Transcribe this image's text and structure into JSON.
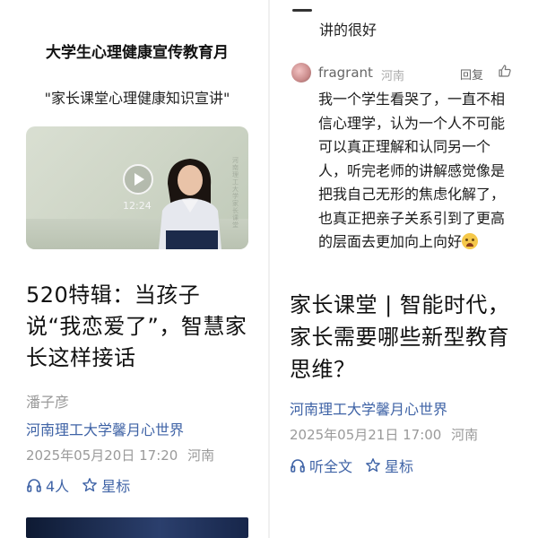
{
  "left_article": {
    "banner_title": "大学生心理健康宣传教育月",
    "banner_subtitle": "\"家长课堂心理健康知识宣讲\"",
    "video": {
      "duration": "12:24",
      "vertical_text": "河南理工大学家长课堂"
    },
    "headline": "520特辑：当孩子说“我恋爱了”，智慧家长这样接话",
    "author": "潘子彦",
    "source": "河南理工大学馨月心世界",
    "date": "2025年05月20日 17:20",
    "location": "河南",
    "listeners": "4人",
    "star_label": "星标"
  },
  "right_article": {
    "previous_comment": "讲的很好",
    "comment": {
      "user": "fragrant",
      "location": "河南",
      "reply_label": "回复",
      "text": "我一个学生看哭了，一直不相信心理学，认为一个人不可能可以真正理解和认同另一个人，听完老师的讲解感觉像是把我自己无形的焦虑化解了，也真正把亲子关系引到了更高的层面去更加向上向好"
    },
    "headline": "家长课堂 | 智能时代，家长需要哪些新型教育思维？",
    "source": "河南理工大学馨月心世界",
    "date": "2025年05月21日 17:00",
    "location": "河南",
    "listen_label": "听全文",
    "star_label": "星标"
  },
  "colors": {
    "link_blue": "#3f63a6",
    "meta_gray": "#9a9a9a"
  }
}
